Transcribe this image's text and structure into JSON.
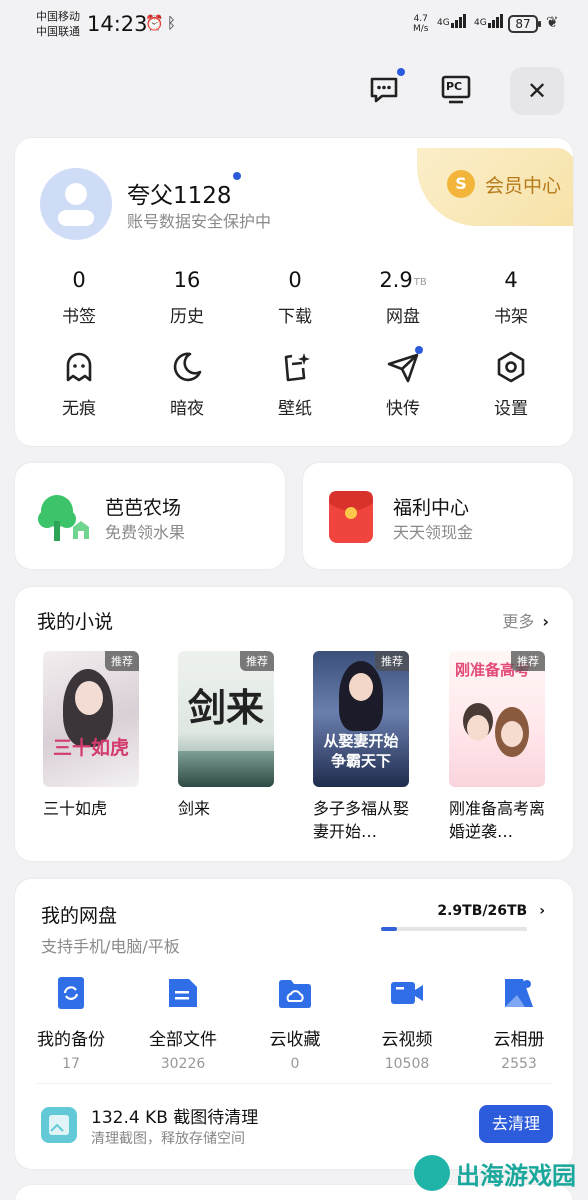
{
  "status_bar": {
    "carrier1": "中国移动",
    "carrier2": "中国联通",
    "time": "14:23",
    "net_speed_value": "4.7",
    "net_speed_unit": "M/s",
    "signal1": "4G",
    "signal2": "4G",
    "battery": "87"
  },
  "top_bar": {
    "message_icon": "message-icon",
    "pc_label": "PC",
    "close_icon": "close-icon"
  },
  "profile": {
    "username": "夸父1128",
    "subtitle": "账号数据安全保护中",
    "vip_badge": "S",
    "vip_label": "会员中心",
    "stats": [
      {
        "num": "0",
        "unit": "",
        "label": "书签"
      },
      {
        "num": "16",
        "unit": "",
        "label": "历史"
      },
      {
        "num": "0",
        "unit": "",
        "label": "下载"
      },
      {
        "num": "2.9",
        "unit": "TB",
        "label": "网盘"
      },
      {
        "num": "4",
        "unit": "",
        "label": "书架"
      }
    ],
    "tools": [
      {
        "label": "无痕",
        "icon": "ghost-icon"
      },
      {
        "label": "暗夜",
        "icon": "moon-icon"
      },
      {
        "label": "壁纸",
        "icon": "wallpaper-icon"
      },
      {
        "label": "快传",
        "icon": "paper-plane-icon"
      },
      {
        "label": "设置",
        "icon": "settings-icon"
      }
    ]
  },
  "farm": {
    "title": "芭芭农场",
    "subtitle": "免费领水果"
  },
  "welfare": {
    "title": "福利中心",
    "subtitle": "天天领现金"
  },
  "novels": {
    "title": "我的小说",
    "more": "更多",
    "books": [
      {
        "title": "三十如虎",
        "tag": "推荐",
        "cover_text": "三十如虎"
      },
      {
        "title": "剑来",
        "tag": "推荐",
        "cover_text": "剑来"
      },
      {
        "title": "多子多福从娶妻开始…",
        "tag": "推荐",
        "cover_text": "从娶妻开始争霸天下"
      },
      {
        "title": "刚准备高考离婚逆袭…",
        "tag": "推荐",
        "cover_text": "刚准备高考"
      }
    ]
  },
  "disk": {
    "title": "我的网盘",
    "subtitle": "支持手机/电脑/平板",
    "quota": "2.9TB/26TB",
    "quota_fraction": 0.11,
    "items": [
      {
        "label": "我的备份",
        "count": "17",
        "icon": "backup-icon"
      },
      {
        "label": "全部文件",
        "count": "30226",
        "icon": "file-icon"
      },
      {
        "label": "云收藏",
        "count": "0",
        "icon": "cloud-folder-icon"
      },
      {
        "label": "云视频",
        "count": "10508",
        "icon": "video-icon"
      },
      {
        "label": "云相册",
        "count": "2553",
        "icon": "photo-icon"
      }
    ],
    "clean_title": "132.4 KB 截图待清理",
    "clean_sub": "清理截图，释放存储空间",
    "clean_button": "去清理"
  },
  "watermark": "出海游戏园",
  "colors": {
    "accent": "#2c5bdc",
    "vip_gold": "#b77a1a",
    "background": "#f2f2f4"
  }
}
